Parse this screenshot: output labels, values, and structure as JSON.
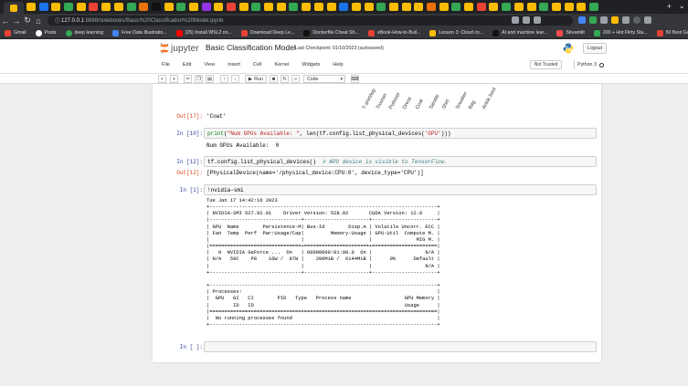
{
  "browser": {
    "url_prefix": "127.0.0.1",
    "url_rest": ":8888/notebooks/Basic%20Classification%20Model.ipynb",
    "tab_colors": [
      "#fbbc04",
      "#1a73e8",
      "#fbbc04",
      "#34a853",
      "#fbbc04",
      "#ea4335",
      "#fbbc04",
      "#fbbc04",
      "#34a853",
      "#e8710a",
      "#111111",
      "#fbbc04",
      "#34a853",
      "#fbbc04",
      "#9334e6",
      "#fbbc04",
      "#ea4335",
      "#fbbc04",
      "#34a853",
      "#fbbc04",
      "#fbbc04",
      "#34a853",
      "#fbbc04",
      "#fbbc04",
      "#fbbc04",
      "#1a73e8",
      "#fbbc04",
      "#fbbc04",
      "#34a853",
      "#fbbc04",
      "#fbbc04",
      "#fbbc04",
      "#e8710a",
      "#fbbc04",
      "#34a853",
      "#fbbc04",
      "#ea4335",
      "#fbbc04",
      "#34a853",
      "#fbbc04",
      "#fbbc04",
      "#34a853",
      "#fbbc04",
      "#fbbc04",
      "#fbbc04",
      "#34a853"
    ],
    "bookmarks": [
      {
        "label": "Gmail",
        "color": "#ea4335"
      },
      {
        "label": "Posts",
        "color": "#ffffff"
      },
      {
        "label": "deep learning",
        "color": "#34a853"
      },
      {
        "label": "Free Data Illustratio...",
        "color": "#4285f4"
      },
      {
        "label": "(25) Install WSL2 on...",
        "color": "#ff0000"
      },
      {
        "label": "Download Deep Le...",
        "color": "#ea4335"
      },
      {
        "label": "Dockerfile Cheat Sh...",
        "color": "#111111"
      },
      {
        "label": "eBook-How-to-Buil...",
        "color": "#ea4335"
      },
      {
        "label": "Lesson 3: Cloud co...",
        "color": "#fbbc04"
      },
      {
        "label": "AI and machine lear...",
        "color": "#111111"
      },
      {
        "label": "Streamlit",
        "color": "#ff4b4b"
      },
      {
        "label": "200 + Hot Flirty Sta...",
        "color": "#34a853"
      },
      {
        "label": "50 Best Good Mornin...",
        "color": "#ea4335"
      }
    ]
  },
  "jupyter": {
    "logo_text": "jupyter",
    "notebook_title": "Basic Classification Model",
    "checkpoint": "Last Checkpoint: 01/10/2023",
    "autosave": "(autosaved)",
    "logout": "Logout",
    "menu": [
      "File",
      "Edit",
      "View",
      "Insert",
      "Cell",
      "Kernel",
      "Widgets",
      "Help"
    ],
    "not_trusted": "Not Trusted",
    "kernel": "Python 3",
    "run_label": "Run",
    "cell_type": "Code"
  },
  "plot_xlabels": [
    "T-shirt/top",
    "Trouser",
    "Pullover",
    "Dress",
    "Coat",
    "Sandal",
    "Shirt",
    "Sneaker",
    "Bag",
    "Ankle boot"
  ],
  "cells": [
    {
      "out_prompt": "Out[17]:",
      "output": "'Coat'"
    },
    {
      "in_prompt": "In [10]:",
      "code_fn": "print",
      "code_str": "\"Num GPUs Available: \"",
      "code_rest": ", len(tf.config.list_physical_devices(",
      "code_str2": "'GPU'",
      "code_end": ")))",
      "output": "Num GPUs Available:  0"
    },
    {
      "in_prompt": "In [12]:",
      "code": "tf.config.list_physical_devices()  ",
      "comment": "# APU device is visible to TensorFlow.",
      "out_prompt": "Out[12]:",
      "output": "[PhysicalDevice(name='/physical_device:CPU:0', device_type='CPU')]"
    },
    {
      "in_prompt": "In [1]:",
      "code": "!nvidia-smi"
    },
    {
      "in_prompt": "In [ ]:",
      "code": ""
    }
  ],
  "nvidia_smi": "Tue Jan 17 14:42:16 2023\n+-----------------------------------------------------------------------------+\n| NVIDIA-SMI 527.92.01    Driver Version: 528.02       CUDA Version: 12.0     |\n|-------------------------------+----------------------+----------------------+\n| GPU  Name        Persistence-M| Bus-Id        Disp.A | Volatile Uncorr. ECC |\n| Fan  Temp  Perf  Pwr:Usage/Cap|         Memory-Usage | GPU-Util  Compute M. |\n|                               |                      |               MIG M. |\n|===============================+======================+======================|\n|   0  NVIDIA GeForce ...  On   | 00000000:01:00.0  On |                  N/A |\n| N/A   59C    P8    16W /  87W |    200MiB /  6144MiB |      0%      Default |\n|                               |                      |                  N/A |\n+-------------------------------+----------------------+----------------------+\n\n+-----------------------------------------------------------------------------+\n| Processes:                                                                  |\n|  GPU   GI   CI        PID   Type   Process name                  GPU Memory |\n|        ID   ID                                                   Usage      |\n|=============================================================================|\n|  No running processes found                                                 |\n+-----------------------------------------------------------------------------+"
}
